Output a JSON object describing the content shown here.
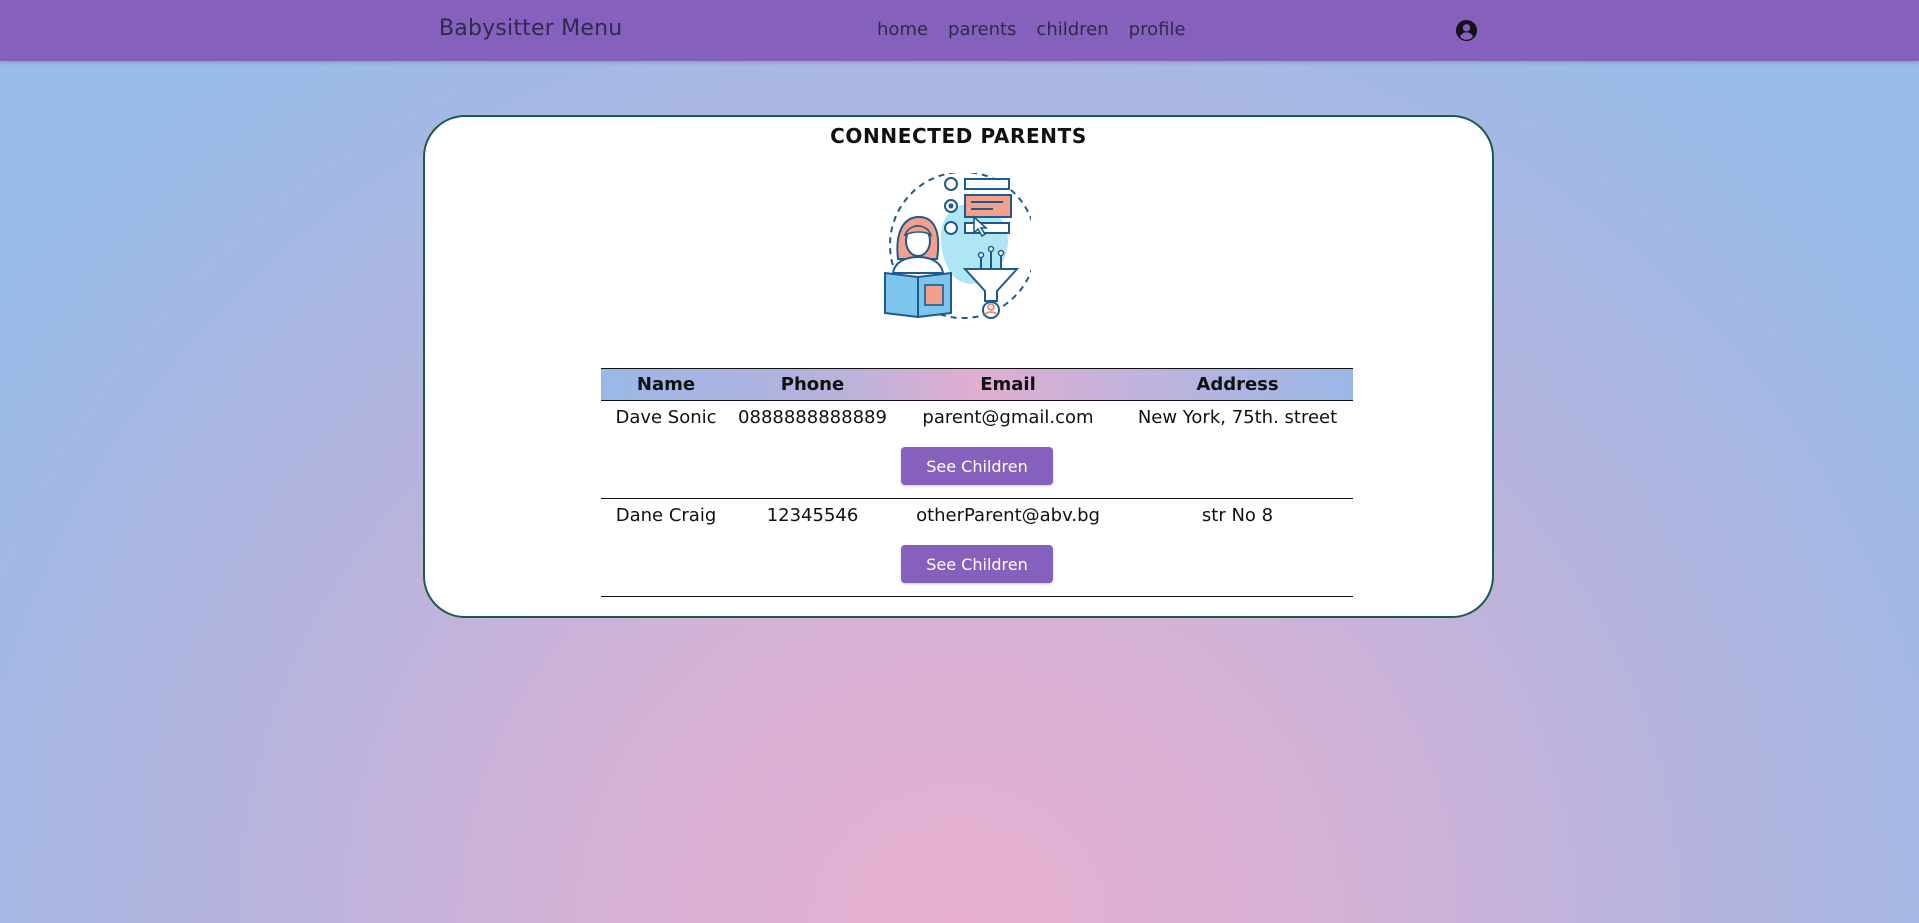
{
  "navbar": {
    "brand": "Babysitter Menu",
    "links": [
      {
        "label": "home"
      },
      {
        "label": "parents"
      },
      {
        "label": "children"
      },
      {
        "label": "profile"
      }
    ],
    "profile_icon": "user-circle-icon",
    "background_color": "#8560bd"
  },
  "main": {
    "title": "CONNECTED PARENTS",
    "illustration": "parent-reading-book-with-filter-illustration",
    "table": {
      "columns": [
        "Name",
        "Phone",
        "Email",
        "Address"
      ],
      "rows": [
        {
          "name": "Dave Sonic",
          "phone": "0888888888889",
          "email": "parent@gmail.com",
          "address": "New York, 75th. street",
          "action_label": "See Children"
        },
        {
          "name": "Dane Craig",
          "phone": "12345546",
          "email": "otherParent@abv.bg",
          "address": "str No 8",
          "action_label": "See Children"
        }
      ]
    }
  },
  "colors": {
    "accent": "#8560bd",
    "card_border": "#1d5b4c"
  }
}
